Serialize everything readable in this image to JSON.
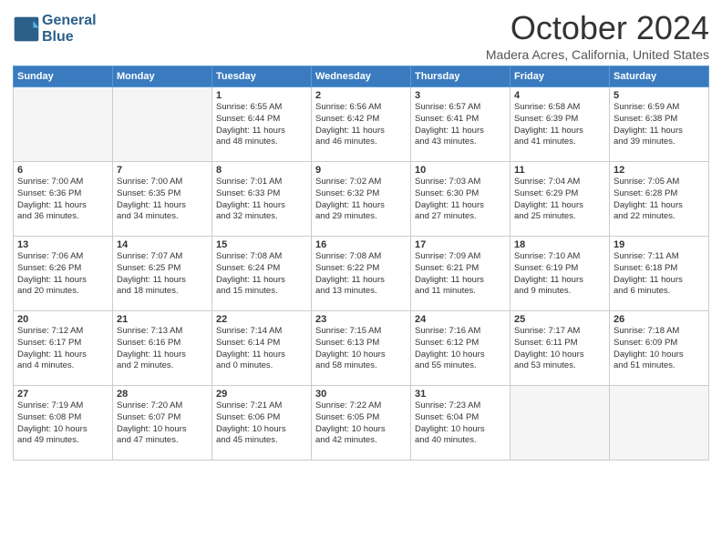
{
  "header": {
    "logo_line1": "General",
    "logo_line2": "Blue",
    "month_title": "October 2024",
    "location": "Madera Acres, California, United States"
  },
  "columns": [
    "Sunday",
    "Monday",
    "Tuesday",
    "Wednesday",
    "Thursday",
    "Friday",
    "Saturday"
  ],
  "weeks": [
    [
      {
        "num": "",
        "info": "",
        "empty": true
      },
      {
        "num": "",
        "info": "",
        "empty": true
      },
      {
        "num": "1",
        "info": "Sunrise: 6:55 AM\nSunset: 6:44 PM\nDaylight: 11 hours\nand 48 minutes."
      },
      {
        "num": "2",
        "info": "Sunrise: 6:56 AM\nSunset: 6:42 PM\nDaylight: 11 hours\nand 46 minutes."
      },
      {
        "num": "3",
        "info": "Sunrise: 6:57 AM\nSunset: 6:41 PM\nDaylight: 11 hours\nand 43 minutes."
      },
      {
        "num": "4",
        "info": "Sunrise: 6:58 AM\nSunset: 6:39 PM\nDaylight: 11 hours\nand 41 minutes."
      },
      {
        "num": "5",
        "info": "Sunrise: 6:59 AM\nSunset: 6:38 PM\nDaylight: 11 hours\nand 39 minutes."
      }
    ],
    [
      {
        "num": "6",
        "info": "Sunrise: 7:00 AM\nSunset: 6:36 PM\nDaylight: 11 hours\nand 36 minutes."
      },
      {
        "num": "7",
        "info": "Sunrise: 7:00 AM\nSunset: 6:35 PM\nDaylight: 11 hours\nand 34 minutes."
      },
      {
        "num": "8",
        "info": "Sunrise: 7:01 AM\nSunset: 6:33 PM\nDaylight: 11 hours\nand 32 minutes."
      },
      {
        "num": "9",
        "info": "Sunrise: 7:02 AM\nSunset: 6:32 PM\nDaylight: 11 hours\nand 29 minutes."
      },
      {
        "num": "10",
        "info": "Sunrise: 7:03 AM\nSunset: 6:30 PM\nDaylight: 11 hours\nand 27 minutes."
      },
      {
        "num": "11",
        "info": "Sunrise: 7:04 AM\nSunset: 6:29 PM\nDaylight: 11 hours\nand 25 minutes."
      },
      {
        "num": "12",
        "info": "Sunrise: 7:05 AM\nSunset: 6:28 PM\nDaylight: 11 hours\nand 22 minutes."
      }
    ],
    [
      {
        "num": "13",
        "info": "Sunrise: 7:06 AM\nSunset: 6:26 PM\nDaylight: 11 hours\nand 20 minutes."
      },
      {
        "num": "14",
        "info": "Sunrise: 7:07 AM\nSunset: 6:25 PM\nDaylight: 11 hours\nand 18 minutes."
      },
      {
        "num": "15",
        "info": "Sunrise: 7:08 AM\nSunset: 6:24 PM\nDaylight: 11 hours\nand 15 minutes."
      },
      {
        "num": "16",
        "info": "Sunrise: 7:08 AM\nSunset: 6:22 PM\nDaylight: 11 hours\nand 13 minutes."
      },
      {
        "num": "17",
        "info": "Sunrise: 7:09 AM\nSunset: 6:21 PM\nDaylight: 11 hours\nand 11 minutes."
      },
      {
        "num": "18",
        "info": "Sunrise: 7:10 AM\nSunset: 6:19 PM\nDaylight: 11 hours\nand 9 minutes."
      },
      {
        "num": "19",
        "info": "Sunrise: 7:11 AM\nSunset: 6:18 PM\nDaylight: 11 hours\nand 6 minutes."
      }
    ],
    [
      {
        "num": "20",
        "info": "Sunrise: 7:12 AM\nSunset: 6:17 PM\nDaylight: 11 hours\nand 4 minutes."
      },
      {
        "num": "21",
        "info": "Sunrise: 7:13 AM\nSunset: 6:16 PM\nDaylight: 11 hours\nand 2 minutes."
      },
      {
        "num": "22",
        "info": "Sunrise: 7:14 AM\nSunset: 6:14 PM\nDaylight: 11 hours\nand 0 minutes."
      },
      {
        "num": "23",
        "info": "Sunrise: 7:15 AM\nSunset: 6:13 PM\nDaylight: 10 hours\nand 58 minutes."
      },
      {
        "num": "24",
        "info": "Sunrise: 7:16 AM\nSunset: 6:12 PM\nDaylight: 10 hours\nand 55 minutes."
      },
      {
        "num": "25",
        "info": "Sunrise: 7:17 AM\nSunset: 6:11 PM\nDaylight: 10 hours\nand 53 minutes."
      },
      {
        "num": "26",
        "info": "Sunrise: 7:18 AM\nSunset: 6:09 PM\nDaylight: 10 hours\nand 51 minutes."
      }
    ],
    [
      {
        "num": "27",
        "info": "Sunrise: 7:19 AM\nSunset: 6:08 PM\nDaylight: 10 hours\nand 49 minutes."
      },
      {
        "num": "28",
        "info": "Sunrise: 7:20 AM\nSunset: 6:07 PM\nDaylight: 10 hours\nand 47 minutes."
      },
      {
        "num": "29",
        "info": "Sunrise: 7:21 AM\nSunset: 6:06 PM\nDaylight: 10 hours\nand 45 minutes."
      },
      {
        "num": "30",
        "info": "Sunrise: 7:22 AM\nSunset: 6:05 PM\nDaylight: 10 hours\nand 42 minutes."
      },
      {
        "num": "31",
        "info": "Sunrise: 7:23 AM\nSunset: 6:04 PM\nDaylight: 10 hours\nand 40 minutes."
      },
      {
        "num": "",
        "info": "",
        "empty": true
      },
      {
        "num": "",
        "info": "",
        "empty": true
      }
    ]
  ]
}
